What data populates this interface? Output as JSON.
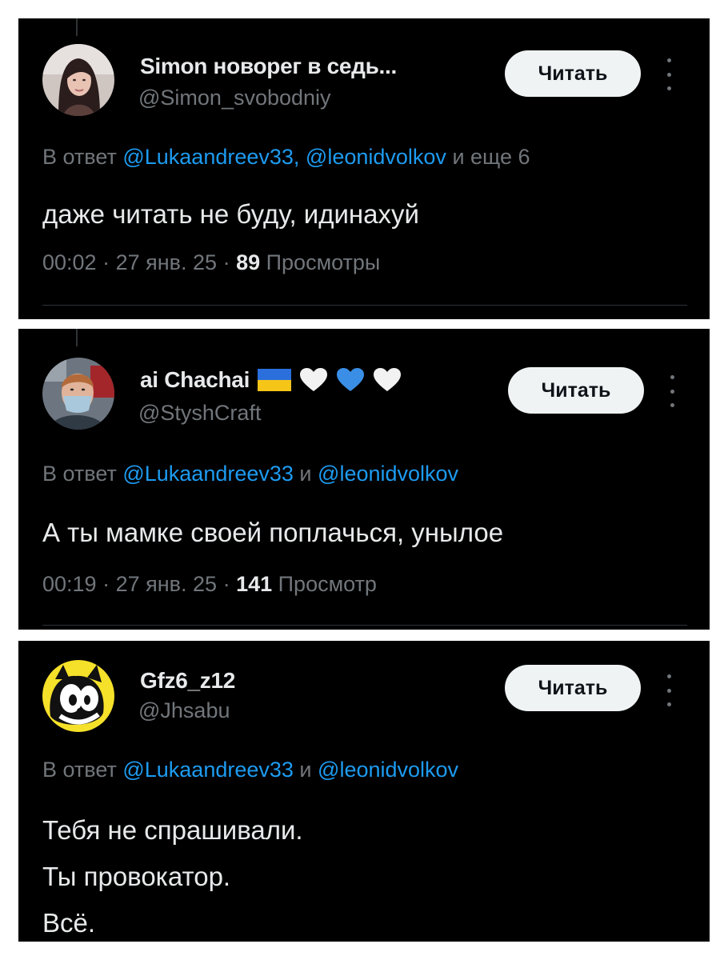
{
  "colors": {
    "background": "#000000",
    "primary_text": "#e7e9ea",
    "secondary_text": "#71767b",
    "mention": "#1d9bf0",
    "button_bg": "#eff3f4",
    "button_text": "#0f1419"
  },
  "tweets": [
    {
      "display_name": "Simon новорег в седь...",
      "handle": "@Simon_svobodniy",
      "follow_label": "Читать",
      "reply_prefix": "В ответ",
      "mentions": "@Lukaandreev33, @leonidvolkov",
      "reply_suffix": "и еще 6",
      "text_lines": [
        "даже читать не буду, идинахуй"
      ],
      "time": "00:02",
      "date": "27 янв. 25",
      "views_count": "89",
      "views_label": "Просмотры",
      "avatar_icon": "profile-photo-woman"
    },
    {
      "display_name": "ai Chachai",
      "name_emoji": [
        "ukraine-flag",
        "white-heart",
        "blue-heart",
        "white-heart"
      ],
      "handle": "@StyshCraft",
      "follow_label": "Читать",
      "reply_prefix": "В ответ",
      "mentions_1": "@Lukaandreev33",
      "and": "и",
      "mentions_2": "@leonidvolkov",
      "text_lines": [
        "А ты мамке своей поплачься,  унылое"
      ],
      "time": "00:19",
      "date": "27 янв. 25",
      "views_count": "141",
      "views_label": "Просмотр",
      "avatar_icon": "profile-photo-man-mask"
    },
    {
      "display_name": "Gfz6_z12",
      "handle": "@Jhsabu",
      "follow_label": "Читать",
      "reply_prefix": "В ответ",
      "mentions_1": "@Lukaandreev33",
      "and": "и",
      "mentions_2": "@leonidvolkov",
      "text_lines": [
        "Тебя не спрашивали.",
        "Ты провокатор.",
        "Всё."
      ],
      "avatar_icon": "cartoon-cat-avatar"
    }
  ]
}
